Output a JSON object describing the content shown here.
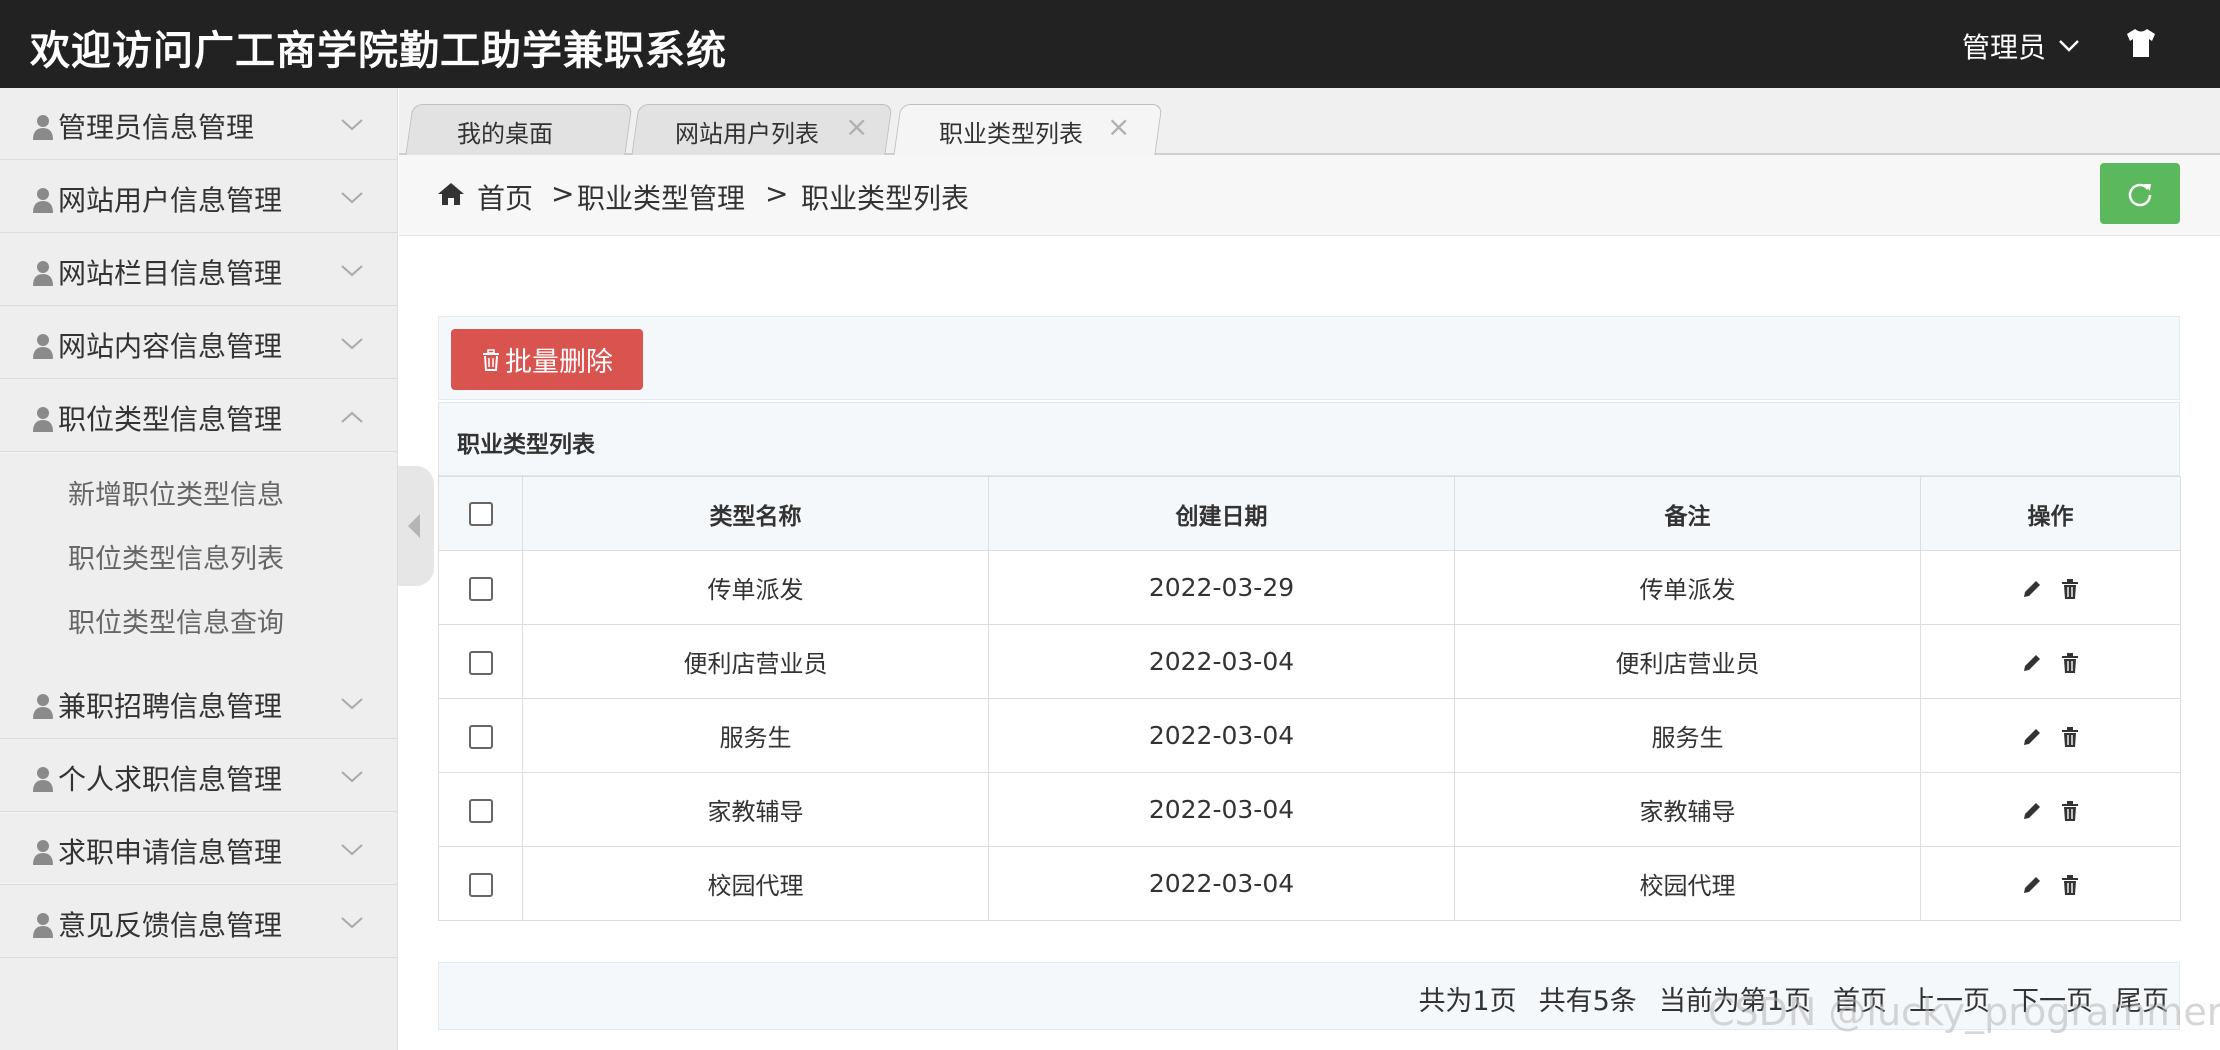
{
  "header": {
    "title": "欢迎访问广工商学院勤工助学兼职系统",
    "user_label": "管理员"
  },
  "sidebar": {
    "groups": [
      {
        "label": "管理员信息管理",
        "expanded": false
      },
      {
        "label": "网站用户信息管理",
        "expanded": false
      },
      {
        "label": "网站栏目信息管理",
        "expanded": false
      },
      {
        "label": "网站内容信息管理",
        "expanded": false
      },
      {
        "label": "职位类型信息管理",
        "expanded": true
      },
      {
        "label": "兼职招聘信息管理",
        "expanded": false
      },
      {
        "label": "个人求职信息管理",
        "expanded": false
      },
      {
        "label": "求职申请信息管理",
        "expanded": false
      },
      {
        "label": "意见反馈信息管理",
        "expanded": false
      }
    ],
    "subitems": [
      "新增职位类型信息",
      "职位类型信息列表",
      "职位类型信息查询"
    ]
  },
  "tabs": [
    {
      "label": "我的桌面",
      "closable": false,
      "active": false
    },
    {
      "label": "网站用户列表",
      "closable": true,
      "active": false
    },
    {
      "label": "职业类型列表",
      "closable": true,
      "active": true
    }
  ],
  "tab_close_glyph": "×",
  "breadcrumb": {
    "home": "首页",
    "sep": ">",
    "level1": "职业类型管理",
    "level2": "职业类型列表"
  },
  "toolbar": {
    "batch_delete_label": "批量删除"
  },
  "panel": {
    "title": "职业类型列表"
  },
  "table": {
    "columns": [
      "类型名称",
      "创建日期",
      "备注",
      "操作"
    ],
    "rows": [
      {
        "name": "传单派发",
        "date": "2022-03-29",
        "note": "传单派发"
      },
      {
        "name": "便利店营业员",
        "date": "2022-03-04",
        "note": "便利店营业员"
      },
      {
        "name": "服务生",
        "date": "2022-03-04",
        "note": "服务生"
      },
      {
        "name": "家教辅导",
        "date": "2022-03-04",
        "note": "家教辅导"
      },
      {
        "name": "校园代理",
        "date": "2022-03-04",
        "note": "校园代理"
      }
    ]
  },
  "pager": {
    "total_pages": "共为1页",
    "total_items": "共有5条",
    "current": "当前为第1页",
    "first": "首页",
    "prev": "上一页",
    "next": "下一页",
    "last": "尾页"
  },
  "watermark": "CSDN @lucky_programmer",
  "colors": {
    "header_bg": "#222222",
    "danger": "#d9534f",
    "success": "#5cb85c",
    "sidebar_bg": "#eeeeee"
  },
  "icons": [
    "person-icon",
    "chevron-down-icon",
    "chevron-up-icon",
    "shirt-icon",
    "home-icon",
    "refresh-icon",
    "trash-icon",
    "pencil-icon",
    "chevron-left-icon"
  ]
}
